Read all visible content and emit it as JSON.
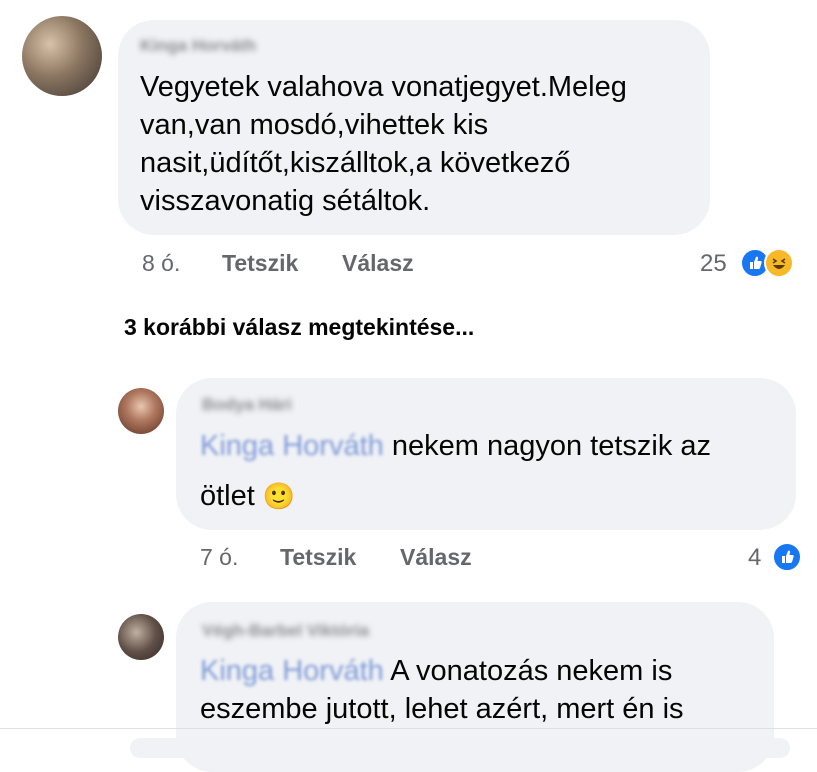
{
  "comments": [
    {
      "author": "Kinga Horváth",
      "text": "Vegyetek valahova vonatjegyet.Meleg van,van mosdó,vihettek kis nasit,üdítőt,kiszálltok,a következő visszavonatig sétáltok.",
      "lines": [
        "Vegyetek valahova vonatjegyet.Meleg",
        "van,van mosdó,vihettek kis",
        "nasit,üdítőt,kiszálltok,a következő",
        "visszavonatig sétáltok."
      ],
      "time": "8 ó.",
      "like_label": "Tetszik",
      "reply_label": "Válasz",
      "reaction_count": "25",
      "reactions": [
        "like-icon",
        "haha-icon"
      ]
    },
    {
      "author": "Bodya Hári",
      "mention": "Kinga Horváth",
      "text_after_mention": " nekem nagyon tetszik az",
      "line2": "ötlet",
      "emoji": "🙂",
      "time": "7 ó.",
      "like_label": "Tetszik",
      "reply_label": "Válasz",
      "reaction_count": "4",
      "reactions": [
        "like-icon"
      ]
    },
    {
      "author": "Végh-Barbel Viktória",
      "mention": "Kinga Horváth",
      "text_after_mention": " A vonatozás nekem is",
      "line2": "eszembe jutott, lehet azért, mert én is"
    }
  ],
  "view_previous": "3 korábbi válasz megtekintése...",
  "colors": {
    "bubble": "#f0f2f5",
    "like_blue": "#1877f2",
    "haha_yellow": "#f7b928",
    "meta_gray": "#65676b"
  }
}
